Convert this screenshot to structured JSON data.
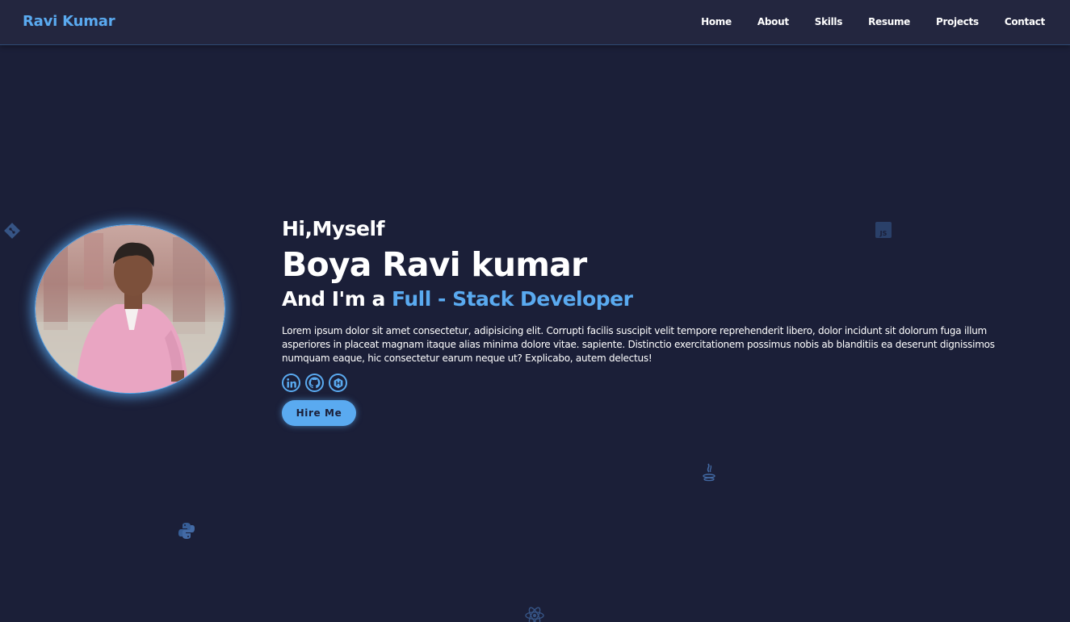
{
  "nav": {
    "brand": "Ravi Kumar",
    "links": [
      "Home",
      "About",
      "Skills",
      "Resume",
      "Projects",
      "Contact"
    ]
  },
  "hero": {
    "greeting": "Hi,Myself",
    "name": "Boya Ravi kumar",
    "role_prefix": "And I'm a ",
    "role_highlight": "Full - Stack Developer",
    "bio": "Lorem ipsum dolor sit amet consectetur, adipisicing elit. Corrupti facilis suscipit velit tempore reprehenderit libero, dolor incidunt sit dolorum fuga illum asperiores in placeat magnam itaque alias minima dolore vitae. sapiente. Distinctio exercitationem possimus nobis ab blanditiis ea deserunt dignissimos numquam eaque, hic consectetur earum neque ut? Explicabo, autem delectus!",
    "socials": [
      "linkedin-icon",
      "github-icon",
      "hackerrank-icon"
    ],
    "hire_label": "Hire Me"
  },
  "decor_icons": [
    "git-icon",
    "javascript-icon",
    "java-icon",
    "python-icon",
    "react-icon"
  ],
  "colors": {
    "background": "#1b1f38",
    "navbar": "#23263f",
    "accent": "#5aaaf0",
    "text": "#ffffff"
  }
}
